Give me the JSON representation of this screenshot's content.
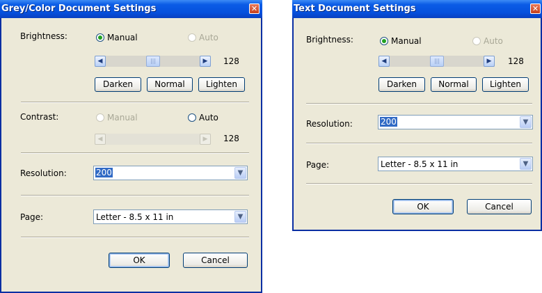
{
  "grey_dialog": {
    "title": "Grey/Color Document Settings",
    "close_glyph": "✕",
    "brightness": {
      "label": "Brightness:",
      "manual": "Manual",
      "auto": "Auto",
      "selected": "manual",
      "value": "128",
      "darken": "Darken",
      "normal": "Normal",
      "lighten": "Lighten"
    },
    "contrast": {
      "label": "Contrast:",
      "manual": "Manual",
      "auto": "Auto",
      "selected": "auto",
      "value": "128"
    },
    "resolution": {
      "label": "Resolution:",
      "value": "200"
    },
    "page": {
      "label": "Page:",
      "value": "Letter - 8.5 x 11 in"
    },
    "ok": "OK",
    "cancel": "Cancel"
  },
  "text_dialog": {
    "title": "Text Document Settings",
    "close_glyph": "✕",
    "brightness": {
      "label": "Brightness:",
      "manual": "Manual",
      "auto": "Auto",
      "selected": "manual",
      "value": "128",
      "darken": "Darken",
      "normal": "Normal",
      "lighten": "Lighten"
    },
    "resolution": {
      "label": "Resolution:",
      "value": "200"
    },
    "page": {
      "label": "Page:",
      "value": "Letter - 8.5 x 11 in"
    },
    "ok": "OK",
    "cancel": "Cancel"
  },
  "icons": {
    "left_arrow": "◀",
    "right_arrow": "▶",
    "thumb_grip": "|||",
    "dropdown": "▼"
  },
  "colors": {
    "title_bar": "#0b5ce6",
    "dialog_bg": "#ece9d8",
    "selection": "#316ac5",
    "radio_dot": "#21a121"
  }
}
